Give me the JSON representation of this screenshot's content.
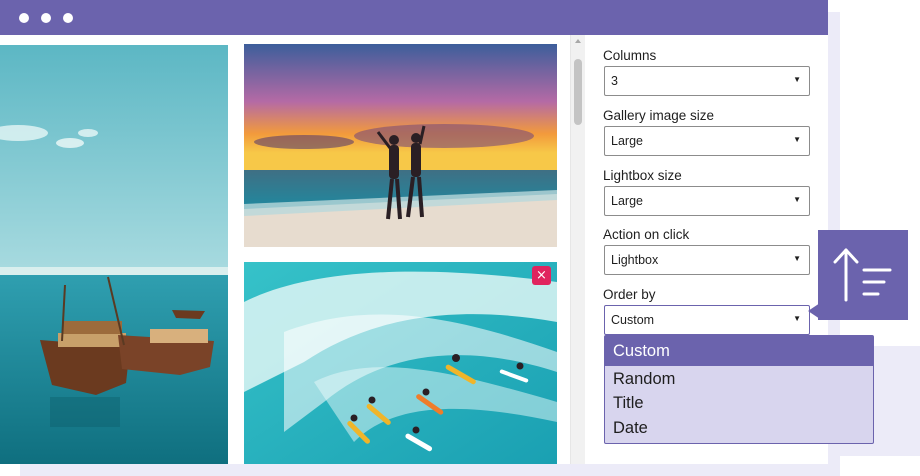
{
  "window": {
    "dots": [
      "close",
      "minimize",
      "maximize"
    ]
  },
  "gallery": {
    "images": [
      {
        "subject": "boats on turquoise sea"
      },
      {
        "subject": "sunset beach silhouettes"
      },
      {
        "subject": "surfers on a wave"
      }
    ],
    "remove_symbol": "×",
    "remove_color": "#e0245e"
  },
  "settings": {
    "columns": {
      "label": "Columns",
      "value": "3"
    },
    "gallery_image_size": {
      "label": "Gallery image size",
      "value": "Large"
    },
    "lightbox_size": {
      "label": "Lightbox size",
      "value": "Large"
    },
    "action_on_click": {
      "label": "Action on click",
      "value": "Lightbox"
    },
    "order_by": {
      "label": "Order by",
      "value": "Custom",
      "options": [
        "Custom",
        "Random",
        "Title",
        "Date"
      ]
    },
    "caret": "▼"
  },
  "colors": {
    "accent": "#6b63ad",
    "dropdown_bg": "#d8d5ee",
    "backdrop": "#ecebf8"
  },
  "icons": {
    "sort": "sort-ascending-icon"
  }
}
